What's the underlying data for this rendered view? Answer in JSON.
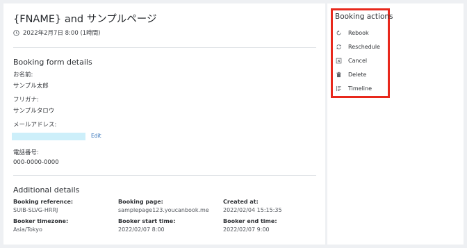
{
  "booking": {
    "title": "{FNAME} and サンプルページ",
    "when": "2022年2月7日 8:00 (1時間)"
  },
  "form_details": {
    "heading": "Booking form details",
    "fields": [
      {
        "label": "お名前:",
        "value": "サンプル太郎"
      },
      {
        "label": "フリガナ:",
        "value": "サンプルタロウ"
      },
      {
        "label": "メールアドレス:",
        "value": ""
      },
      {
        "label": "電話番号:",
        "value": "000-0000-0000"
      }
    ],
    "edit_label": "Edit"
  },
  "additional": {
    "heading": "Additional details",
    "items": [
      {
        "label": "Booking reference:",
        "value": "SUIB-SLVG-HRRJ"
      },
      {
        "label": "Booking page:",
        "value": "samplepage123.youcanbook.me"
      },
      {
        "label": "Created at:",
        "value": "2022/02/04 15:15:35"
      },
      {
        "label": "Booker timezone:",
        "value": "Asia/Tokyo"
      },
      {
        "label": "Booker start time:",
        "value": "2022/02/07 8:00"
      },
      {
        "label": "Booker end time:",
        "value": "2022/02/07 9:00"
      }
    ]
  },
  "actions": {
    "heading": "Booking actions",
    "items": [
      {
        "label": "Rebook",
        "icon": "rebook-icon"
      },
      {
        "label": "Reschedule",
        "icon": "reschedule-icon"
      },
      {
        "label": "Cancel",
        "icon": "cancel-icon"
      },
      {
        "label": "Delete",
        "icon": "trash-icon"
      },
      {
        "label": "Timeline",
        "icon": "timeline-icon"
      }
    ]
  },
  "colors": {
    "highlight_border": "#e8281c",
    "link": "#2f6fb8",
    "email_mask": "#cdeffa"
  }
}
